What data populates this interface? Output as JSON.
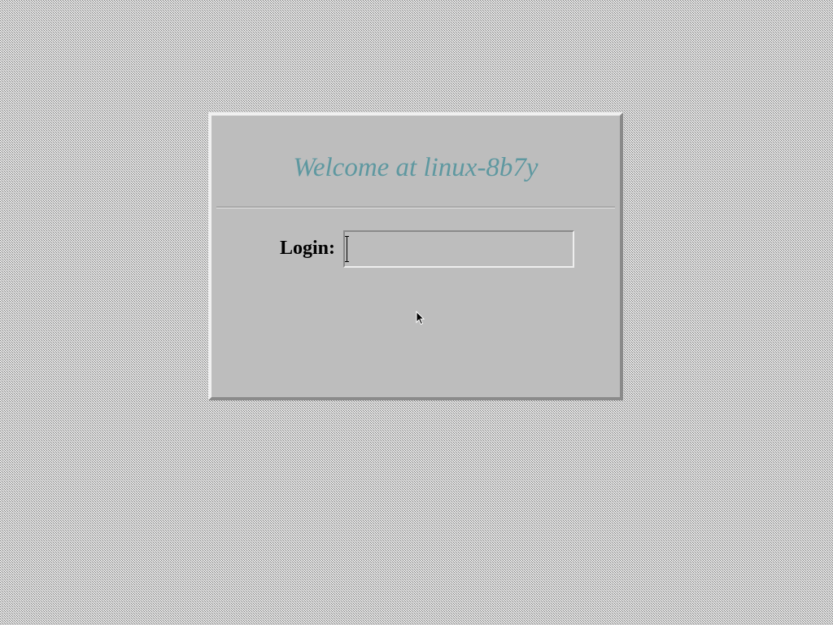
{
  "greeter": {
    "welcome_text": "Welcome at linux-8b7y",
    "login_label": "Login:",
    "login_value": ""
  },
  "icons": {
    "text_cursor": "i-beam-cursor-icon",
    "mouse_pointer": "arrow-pointer-icon"
  },
  "colors": {
    "welcome_text": "#5e98a0",
    "panel_background": "#bdbdbd"
  }
}
